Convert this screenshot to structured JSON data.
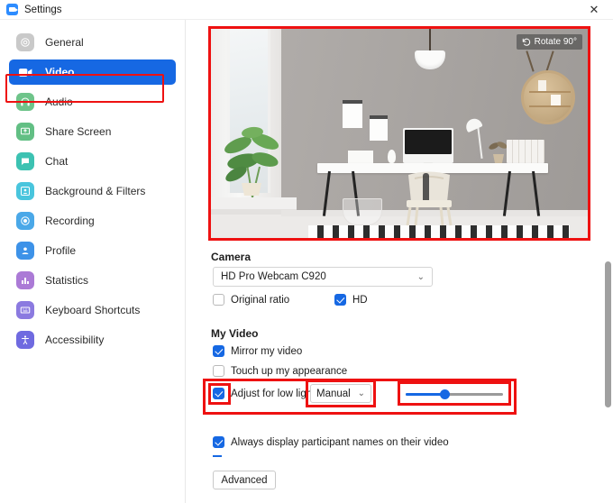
{
  "window": {
    "title": "Settings",
    "app_icon": "zoom-video-icon",
    "close_label": "✕"
  },
  "sidebar": {
    "items": [
      {
        "label": "General",
        "icon": "gear-icon",
        "color": "#c9c9c9",
        "active": false
      },
      {
        "label": "Video",
        "icon": "video-camera-icon",
        "color": "#1668e3",
        "active": true
      },
      {
        "label": "Audio",
        "icon": "headphones-icon",
        "color": "#6ec48a",
        "active": false
      },
      {
        "label": "Share Screen",
        "icon": "share-screen-icon",
        "color": "#62bf84",
        "active": false
      },
      {
        "label": "Chat",
        "icon": "chat-bubble-icon",
        "color": "#3cc2b2",
        "active": false
      },
      {
        "label": "Background & Filters",
        "icon": "person-frame-icon",
        "color": "#49c5dd",
        "active": false
      },
      {
        "label": "Recording",
        "icon": "record-circle-icon",
        "color": "#4aa8e8",
        "active": false
      },
      {
        "label": "Profile",
        "icon": "person-icon",
        "color": "#3d92e8",
        "active": false
      },
      {
        "label": "Statistics",
        "icon": "bar-chart-icon",
        "color": "#ab7ad6",
        "active": false
      },
      {
        "label": "Keyboard Shortcuts",
        "icon": "keyboard-icon",
        "color": "#8b7ae0",
        "active": false
      },
      {
        "label": "Accessibility",
        "icon": "accessibility-icon",
        "color": "#6f6ae0",
        "active": false
      }
    ]
  },
  "preview": {
    "rotate_label": "Rotate 90°",
    "rotate_icon": "rotate-ccw-icon",
    "scene": "home-office-desk-with-monitor-plants-and-pendant-lamp"
  },
  "camera": {
    "section_title": "Camera",
    "selected_device": "HD Pro Webcam C920",
    "chevron": "⌄",
    "original_ratio": {
      "label": "Original ratio",
      "checked": false
    },
    "hd": {
      "label": "HD",
      "checked": true
    }
  },
  "my_video": {
    "section_title": "My Video",
    "mirror": {
      "label": "Mirror my video",
      "checked": true
    },
    "touch_up": {
      "label": "Touch up my appearance",
      "checked": false
    },
    "low_light": {
      "label": "Adjust for low light",
      "checked": true,
      "mode": "Manual",
      "chevron": "⌄",
      "slider_percent": 40
    }
  },
  "other": {
    "display_names": {
      "label": "Always display participant names on their video",
      "checked": true
    },
    "advanced_label": "Advanced"
  },
  "annotations": {
    "color": "#ee1111",
    "targets": [
      "video-nav-item",
      "video-preview",
      "low-light-row",
      "low-light-checkbox",
      "low-light-mode-select",
      "low-light-slider"
    ]
  }
}
